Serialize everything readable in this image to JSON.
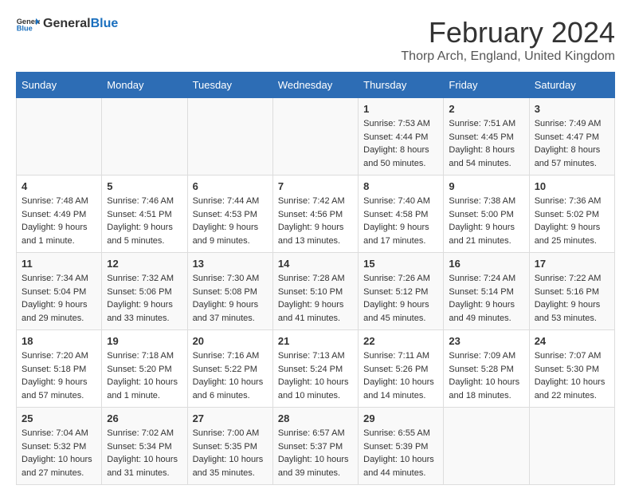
{
  "header": {
    "logo": {
      "text_general": "General",
      "text_blue": "Blue"
    },
    "title": "February 2024",
    "location": "Thorp Arch, England, United Kingdom"
  },
  "calendar": {
    "days_of_week": [
      "Sunday",
      "Monday",
      "Tuesday",
      "Wednesday",
      "Thursday",
      "Friday",
      "Saturday"
    ],
    "weeks": [
      [
        {
          "day": "",
          "info": ""
        },
        {
          "day": "",
          "info": ""
        },
        {
          "day": "",
          "info": ""
        },
        {
          "day": "",
          "info": ""
        },
        {
          "day": "1",
          "info": "Sunrise: 7:53 AM\nSunset: 4:44 PM\nDaylight: 8 hours and 50 minutes."
        },
        {
          "day": "2",
          "info": "Sunrise: 7:51 AM\nSunset: 4:45 PM\nDaylight: 8 hours and 54 minutes."
        },
        {
          "day": "3",
          "info": "Sunrise: 7:49 AM\nSunset: 4:47 PM\nDaylight: 8 hours and 57 minutes."
        }
      ],
      [
        {
          "day": "4",
          "info": "Sunrise: 7:48 AM\nSunset: 4:49 PM\nDaylight: 9 hours and 1 minute."
        },
        {
          "day": "5",
          "info": "Sunrise: 7:46 AM\nSunset: 4:51 PM\nDaylight: 9 hours and 5 minutes."
        },
        {
          "day": "6",
          "info": "Sunrise: 7:44 AM\nSunset: 4:53 PM\nDaylight: 9 hours and 9 minutes."
        },
        {
          "day": "7",
          "info": "Sunrise: 7:42 AM\nSunset: 4:56 PM\nDaylight: 9 hours and 13 minutes."
        },
        {
          "day": "8",
          "info": "Sunrise: 7:40 AM\nSunset: 4:58 PM\nDaylight: 9 hours and 17 minutes."
        },
        {
          "day": "9",
          "info": "Sunrise: 7:38 AM\nSunset: 5:00 PM\nDaylight: 9 hours and 21 minutes."
        },
        {
          "day": "10",
          "info": "Sunrise: 7:36 AM\nSunset: 5:02 PM\nDaylight: 9 hours and 25 minutes."
        }
      ],
      [
        {
          "day": "11",
          "info": "Sunrise: 7:34 AM\nSunset: 5:04 PM\nDaylight: 9 hours and 29 minutes."
        },
        {
          "day": "12",
          "info": "Sunrise: 7:32 AM\nSunset: 5:06 PM\nDaylight: 9 hours and 33 minutes."
        },
        {
          "day": "13",
          "info": "Sunrise: 7:30 AM\nSunset: 5:08 PM\nDaylight: 9 hours and 37 minutes."
        },
        {
          "day": "14",
          "info": "Sunrise: 7:28 AM\nSunset: 5:10 PM\nDaylight: 9 hours and 41 minutes."
        },
        {
          "day": "15",
          "info": "Sunrise: 7:26 AM\nSunset: 5:12 PM\nDaylight: 9 hours and 45 minutes."
        },
        {
          "day": "16",
          "info": "Sunrise: 7:24 AM\nSunset: 5:14 PM\nDaylight: 9 hours and 49 minutes."
        },
        {
          "day": "17",
          "info": "Sunrise: 7:22 AM\nSunset: 5:16 PM\nDaylight: 9 hours and 53 minutes."
        }
      ],
      [
        {
          "day": "18",
          "info": "Sunrise: 7:20 AM\nSunset: 5:18 PM\nDaylight: 9 hours and 57 minutes."
        },
        {
          "day": "19",
          "info": "Sunrise: 7:18 AM\nSunset: 5:20 PM\nDaylight: 10 hours and 1 minute."
        },
        {
          "day": "20",
          "info": "Sunrise: 7:16 AM\nSunset: 5:22 PM\nDaylight: 10 hours and 6 minutes."
        },
        {
          "day": "21",
          "info": "Sunrise: 7:13 AM\nSunset: 5:24 PM\nDaylight: 10 hours and 10 minutes."
        },
        {
          "day": "22",
          "info": "Sunrise: 7:11 AM\nSunset: 5:26 PM\nDaylight: 10 hours and 14 minutes."
        },
        {
          "day": "23",
          "info": "Sunrise: 7:09 AM\nSunset: 5:28 PM\nDaylight: 10 hours and 18 minutes."
        },
        {
          "day": "24",
          "info": "Sunrise: 7:07 AM\nSunset: 5:30 PM\nDaylight: 10 hours and 22 minutes."
        }
      ],
      [
        {
          "day": "25",
          "info": "Sunrise: 7:04 AM\nSunset: 5:32 PM\nDaylight: 10 hours and 27 minutes."
        },
        {
          "day": "26",
          "info": "Sunrise: 7:02 AM\nSunset: 5:34 PM\nDaylight: 10 hours and 31 minutes."
        },
        {
          "day": "27",
          "info": "Sunrise: 7:00 AM\nSunset: 5:35 PM\nDaylight: 10 hours and 35 minutes."
        },
        {
          "day": "28",
          "info": "Sunrise: 6:57 AM\nSunset: 5:37 PM\nDaylight: 10 hours and 39 minutes."
        },
        {
          "day": "29",
          "info": "Sunrise: 6:55 AM\nSunset: 5:39 PM\nDaylight: 10 hours and 44 minutes."
        },
        {
          "day": "",
          "info": ""
        },
        {
          "day": "",
          "info": ""
        }
      ]
    ]
  }
}
